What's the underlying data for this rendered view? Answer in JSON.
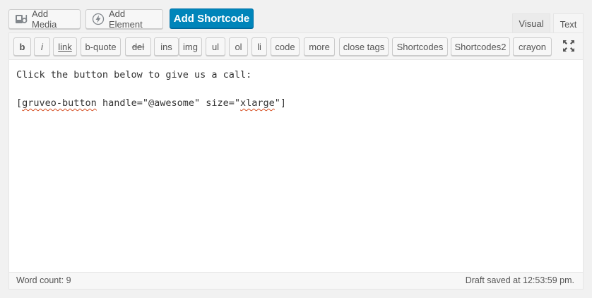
{
  "media_buttons": {
    "add_media": "Add Media",
    "add_element": "Add Element",
    "add_shortcode": "Add Shortcode"
  },
  "editor_tabs": {
    "visual": "Visual",
    "text": "Text",
    "active": "Text"
  },
  "quicktags": [
    {
      "label": "b",
      "name": "qt-bold-button"
    },
    {
      "label": "i",
      "name": "qt-italic-button"
    },
    {
      "label": "link",
      "name": "qt-link-button"
    },
    {
      "label": "b-quote",
      "name": "qt-blockquote-button"
    },
    {
      "label": "del",
      "name": "qt-del-button"
    },
    {
      "label": "ins",
      "name": "qt-ins-button"
    },
    {
      "label": "img",
      "name": "qt-img-button"
    },
    {
      "label": "ul",
      "name": "qt-ul-button"
    },
    {
      "label": "ol",
      "name": "qt-ol-button"
    },
    {
      "label": "li",
      "name": "qt-li-button"
    },
    {
      "label": "code",
      "name": "qt-code-button"
    },
    {
      "label": "more",
      "name": "qt-more-button"
    },
    {
      "label": "close tags",
      "name": "qt-close-tags-button"
    },
    {
      "label": "Shortcodes",
      "name": "qt-shortcodes-button"
    },
    {
      "label": "Shortcodes2",
      "name": "qt-shortcodes2-button"
    },
    {
      "label": "crayon",
      "name": "qt-crayon-button"
    }
  ],
  "content": {
    "line1": "Click the button below to give us a call:",
    "line2_pre": "[",
    "line2_word1": "gruveo-button",
    "line2_mid": " handle=\"@awesome\" size=\"",
    "line2_word2": "xlarge",
    "line2_post": "\"]"
  },
  "status": {
    "word_count": "Word count: 9",
    "draft_saved": "Draft saved at 12:53:59 pm."
  },
  "colors": {
    "accent": "#0085ba",
    "spellcheck_underline": "#d54e21"
  },
  "icons": {
    "add_media": "media-icon",
    "add_element": "bolt-icon",
    "fullscreen": "fullscreen-expand-icon"
  }
}
